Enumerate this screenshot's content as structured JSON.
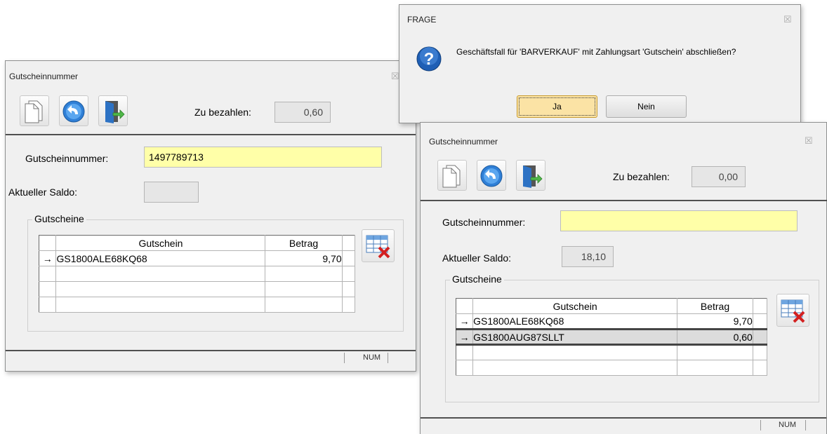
{
  "frage": {
    "title": "FRAGE",
    "message": "Geschäftsfall für 'BARVERKAUF' mit Zahlungsart 'Gutschein' abschließen?",
    "yes_label": "Ja",
    "no_label": "Nein",
    "close_glyph": "☒"
  },
  "left_dialog": {
    "title": "Gutscheinnummer",
    "close_glyph": "☒",
    "zu_bezahlen_label": "Zu bezahlen:",
    "zu_bezahlen_value": "0,60",
    "gutscheinnummer_label": "Gutscheinnummer:",
    "gutscheinnummer_value": "1497789713",
    "saldo_label": "Aktueller Saldo:",
    "saldo_value": "",
    "group_label": "Gutscheine",
    "columns": [
      "Gutschein",
      "Betrag"
    ],
    "rows": [
      {
        "indicator": "→",
        "gutschein": "GS1800ALE68KQ68",
        "betrag": "9,70"
      }
    ],
    "status_num": "NUM"
  },
  "right_dialog": {
    "title": "Gutscheinnummer",
    "close_glyph": "☒",
    "zu_bezahlen_label": "Zu bezahlen:",
    "zu_bezahlen_value": "0,00",
    "gutscheinnummer_label": "Gutscheinnummer:",
    "gutscheinnummer_value": "",
    "saldo_label": "Aktueller Saldo:",
    "saldo_value": "18,10",
    "group_label": "Gutscheine",
    "columns": [
      "Gutschein",
      "Betrag"
    ],
    "rows": [
      {
        "indicator": "→",
        "gutschein": "GS1800ALE68KQ68",
        "betrag": "9,70"
      },
      {
        "indicator": "→",
        "gutschein": "GS1800AUG87SLLT",
        "betrag": "0,60"
      }
    ],
    "status_num": "NUM"
  },
  "icons": {
    "toolbar": [
      "new-document-icon",
      "undo-icon",
      "exit-door-icon"
    ],
    "grid_delete": "grid-delete-icon",
    "question": "question-icon"
  },
  "colors": {
    "input_yellow": "#ffffa8",
    "window_bg": "#f0f0f0",
    "yes_button_bg": "#fbe3a5"
  }
}
